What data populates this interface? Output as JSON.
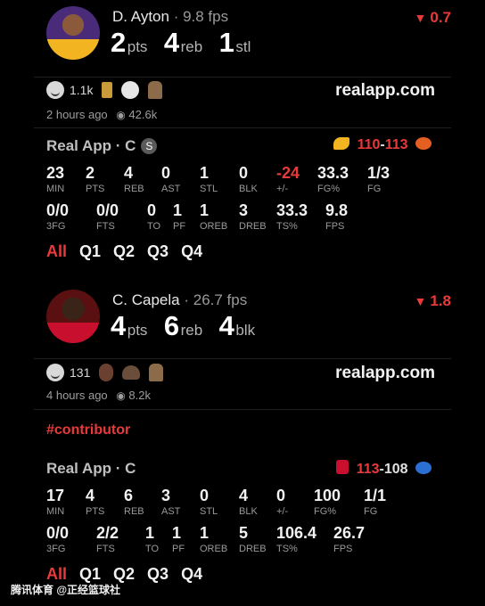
{
  "posts": [
    {
      "player": {
        "name": "D. Ayton",
        "fps_text": "9.8 fps"
      },
      "line": [
        {
          "value": "2",
          "unit": "pts"
        },
        {
          "value": "4",
          "unit": "reb"
        },
        {
          "value": "1",
          "unit": "stl"
        }
      ],
      "rating": "0.7",
      "reactions": {
        "count": "1.1k"
      },
      "site": "realapp.com",
      "time": "2 hours ago",
      "views": "42.6k",
      "game": {
        "title": "Real App · C",
        "badge": "S",
        "score_a": "110",
        "score_b": "113"
      },
      "row1": [
        {
          "v": "23",
          "l": "MIN"
        },
        {
          "v": "2",
          "l": "PTS"
        },
        {
          "v": "4",
          "l": "REB"
        },
        {
          "v": "0",
          "l": "AST"
        },
        {
          "v": "1",
          "l": "STL"
        },
        {
          "v": "0",
          "l": "BLK"
        },
        {
          "v": "-24",
          "l": "+/-"
        },
        {
          "v": "33.3",
          "l": "FG%"
        },
        {
          "v": "1/3",
          "l": "FG"
        }
      ],
      "row2": [
        {
          "v": "0/0",
          "l": "3FG"
        },
        {
          "v": "0/0",
          "l": "FTS"
        },
        {
          "v": "0",
          "l": "TO"
        },
        {
          "v": "1",
          "l": "PF"
        },
        {
          "v": "1",
          "l": "OREB"
        },
        {
          "v": "3",
          "l": "DREB"
        },
        {
          "v": "33.3",
          "l": "TS%"
        },
        {
          "v": "9.8",
          "l": "FPS"
        }
      ],
      "tabs": [
        "All",
        "Q1",
        "Q2",
        "Q3",
        "Q4"
      ]
    },
    {
      "player": {
        "name": "C. Capela",
        "fps_text": "26.7 fps"
      },
      "line": [
        {
          "value": "4",
          "unit": "pts"
        },
        {
          "value": "6",
          "unit": "reb"
        },
        {
          "value": "4",
          "unit": "blk"
        }
      ],
      "rating": "1.8",
      "reactions": {
        "count": "131"
      },
      "site": "realapp.com",
      "time": "4 hours ago",
      "views": "8.2k",
      "hashtag": "#contributor",
      "game": {
        "title": "Real App · C",
        "score_a": "113",
        "score_b": "108"
      },
      "row1": [
        {
          "v": "17",
          "l": "MIN"
        },
        {
          "v": "4",
          "l": "PTS"
        },
        {
          "v": "6",
          "l": "REB"
        },
        {
          "v": "3",
          "l": "AST"
        },
        {
          "v": "0",
          "l": "STL"
        },
        {
          "v": "4",
          "l": "BLK"
        },
        {
          "v": "0",
          "l": "+/-"
        },
        {
          "v": "100",
          "l": "FG%"
        },
        {
          "v": "1/1",
          "l": "FG"
        }
      ],
      "row2": [
        {
          "v": "0/0",
          "l": "3FG"
        },
        {
          "v": "2/2",
          "l": "FTS"
        },
        {
          "v": "1",
          "l": "TO"
        },
        {
          "v": "1",
          "l": "PF"
        },
        {
          "v": "1",
          "l": "OREB"
        },
        {
          "v": "5",
          "l": "DREB"
        },
        {
          "v": "106.4",
          "l": "TS%"
        },
        {
          "v": "26.7",
          "l": "FPS"
        }
      ],
      "tabs": [
        "All",
        "Q1",
        "Q2",
        "Q3",
        "Q4"
      ]
    }
  ],
  "watermark": "腾讯体育 @正经篮球社"
}
